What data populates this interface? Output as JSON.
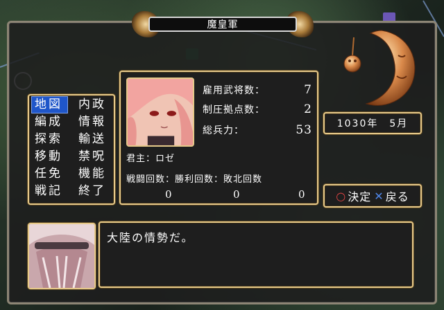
{
  "title": "魔皇軍",
  "menu": {
    "items": [
      {
        "label": "地図",
        "selected": true
      },
      {
        "label": "内政",
        "selected": false
      },
      {
        "label": "編成",
        "selected": false
      },
      {
        "label": "情報",
        "selected": false
      },
      {
        "label": "探索",
        "selected": false
      },
      {
        "label": "輸送",
        "selected": false
      },
      {
        "label": "移動",
        "selected": false
      },
      {
        "label": "禁呪",
        "selected": false
      },
      {
        "label": "任免",
        "selected": false
      },
      {
        "label": "機能",
        "selected": false
      },
      {
        "label": "戦記",
        "selected": false
      },
      {
        "label": "終了",
        "selected": false
      }
    ]
  },
  "info": {
    "generals_label": "雇用武将数：",
    "generals_value": "7",
    "bases_label": "制圧拠点数：",
    "bases_value": "2",
    "troops_label": "総兵力：",
    "troops_value": "53",
    "lord": "君主：ロゼ",
    "battle_header": "戦闘回数：勝利回数：敗北回数",
    "battles_value": "0",
    "wins_value": "0",
    "losses_value": "0"
  },
  "date": "1030年　5月",
  "controls": {
    "circle_glyph": "○",
    "confirm_label": "決定",
    "cross_glyph": "✕",
    "back_label": "戻る"
  },
  "dialog": {
    "text": "大陸の情勢だ。"
  },
  "colors": {
    "frame_gold": "#e6c98a",
    "selected_menu": "#1f56c9",
    "confirm_circle": "#e14444",
    "back_cross": "#4f86e8"
  }
}
